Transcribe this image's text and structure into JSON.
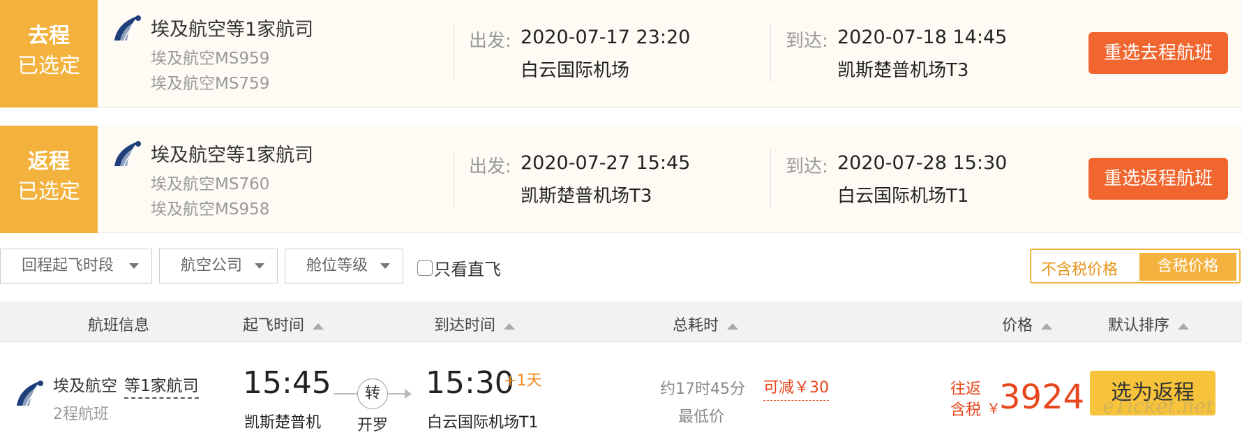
{
  "outbound": {
    "tag_direction": "去程",
    "tag_status": "已选定",
    "airline": "埃及航空等1家航司",
    "flights": [
      "埃及航空MS959",
      "埃及航空MS759"
    ],
    "depart_label": "出发:",
    "depart_time": "2020-07-17 23:20",
    "depart_airport": "白云国际机场",
    "arrive_label": "到达:",
    "arrive_time": "2020-07-18 14:45",
    "arrive_airport": "凯斯楚普机场T3",
    "reselect_label": "重选去程航班"
  },
  "return": {
    "tag_direction": "返程",
    "tag_status": "已选定",
    "airline": "埃及航空等1家航司",
    "flights": [
      "埃及航空MS760",
      "埃及航空MS958"
    ],
    "depart_label": "出发:",
    "depart_time": "2020-07-27 15:45",
    "depart_airport": "凯斯楚普机场T3",
    "arrive_label": "到达:",
    "arrive_time": "2020-07-28 15:30",
    "arrive_airport": "白云国际机场T1",
    "reselect_label": "重选返程航班"
  },
  "filters": {
    "time_slot": "回程起飞时段",
    "airline": "航空公司",
    "cabin": "舱位等级",
    "direct_only": "只看直飞",
    "direct_checked": false,
    "tax_excluded": "不含税价格",
    "tax_included": "含税价格"
  },
  "columns": {
    "flight_info": "航班信息",
    "depart_time": "起飞时间",
    "arrive_time": "到达时间",
    "duration": "总耗时",
    "price": "价格",
    "default_sort": "默认排序"
  },
  "result": {
    "airline": "埃及航空",
    "more_airlines": "等1家航司",
    "legs": "2程航班",
    "depart_time": "15:45",
    "depart_airport": "凯斯楚普机",
    "transfer_mark": "转",
    "transfer_city": "开罗",
    "arrive_time": "15:30",
    "arrive_plus_day": "+1天",
    "arrive_airport": "白云国际机场T1",
    "duration": "约17时45分",
    "lowest_price": "最低价",
    "discount": "可减￥30",
    "round_trip_label": "往返",
    "tax_label": "含税",
    "currency": "￥",
    "price": "3924",
    "select_label": "选为返程"
  },
  "watermark": "eTicket.net",
  "colors": {
    "tag_bg": "#f3b23d",
    "reselect_bg": "#f0662e",
    "price": "#e8461d",
    "select_bg": "#f6c33a"
  }
}
